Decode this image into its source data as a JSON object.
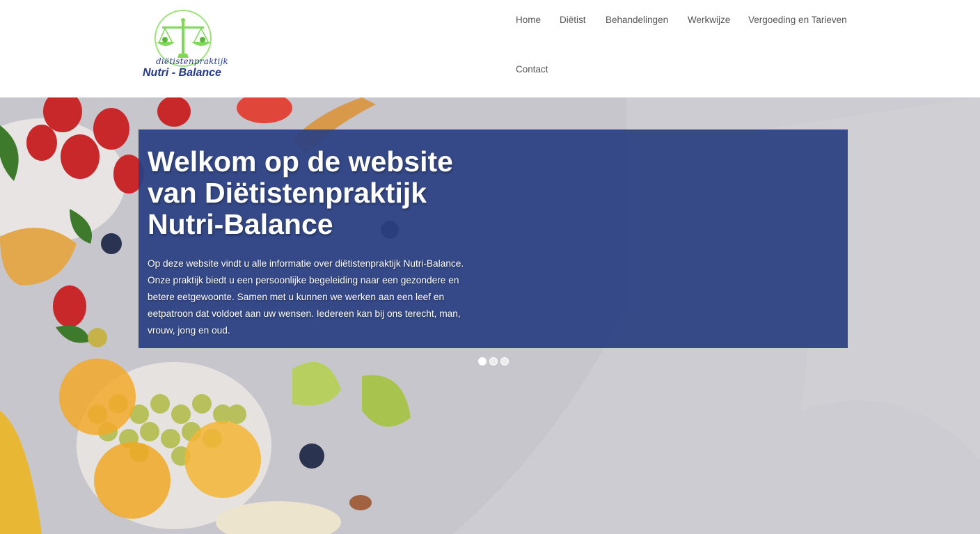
{
  "logo": {
    "line1": "diëtistenpraktijk",
    "line2": "Nutri - Balance",
    "icon": "scale-icon"
  },
  "nav": {
    "items": [
      {
        "label": "Home"
      },
      {
        "label": "Diëtist"
      },
      {
        "label": "Behandelingen"
      },
      {
        "label": "Werkwijze"
      },
      {
        "label": "Vergoeding en Tarieven"
      },
      {
        "label": "Contact"
      }
    ]
  },
  "hero": {
    "title": "Welkom op de website van Diëtistenpraktijk Nutri-Balance",
    "text": "Op deze website vindt u alle informatie over diëtistenpraktijk Nutri-Balance. Onze praktijk biedt u een persoonlijke begeleiding naar een gezondere en betere eetgewoonte. Samen met u kunnen we werken aan een leef en eetpatroon dat voldoet aan uw wensen. Iedereen kan bij ons terecht, man, vrouw, jong en oud.",
    "slides": 3,
    "active_slide": 1
  },
  "colors": {
    "panel": "#2a4082",
    "logo_green": "#8fe06a",
    "logo_blue": "#243a8c"
  }
}
